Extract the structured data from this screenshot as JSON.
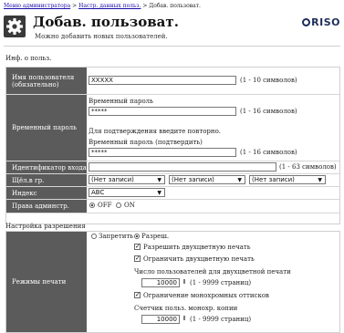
{
  "breadcrumb": {
    "items": [
      "Меню администратора",
      "Настр. данных польз.",
      "Добав. пользоват."
    ],
    "separator": ">"
  },
  "page": {
    "title": "Добав. пользоват.",
    "subtitle": "Можно добавить новых пользователей.",
    "logo": "RISO"
  },
  "user_info": {
    "section_title": "Инф. о польз.",
    "username": {
      "label": "Имя пользователя (обязательно)",
      "value": "XXXXX",
      "hint": "(1 - 10 символов)"
    },
    "temp_password": {
      "label": "Временный пароль",
      "caption1": "Временный пароль",
      "value1": "*****",
      "hint1": "(1 - 16 символов)",
      "confirm_note": "Для подтверждения введите повторно.",
      "caption2": "Временный пароль (подтвердить)",
      "value2": "*****",
      "hint2": "(1 - 16 символов)"
    },
    "login_id": {
      "label": "Идентификатор входа",
      "value": "",
      "hint": "(1 - 63 символов)"
    },
    "group": {
      "label": "Щёл.в гр.",
      "options": [
        "(Нет записи)",
        "(Нет записи)",
        "(Нет записи)"
      ]
    },
    "index": {
      "label": "Индекс",
      "value": "ABC"
    },
    "admin": {
      "label": "Права админстр.",
      "off": "OFF",
      "on": "ON",
      "selected": "OFF"
    }
  },
  "permissions": {
    "section_title": "Настройка разрешения",
    "print_mode": {
      "label": "Режимы печати",
      "deny": "Запретить",
      "allow": "Разреш.",
      "selected": "allow",
      "allow_duplex": "Разрешить двухцветную печать",
      "limit_duplex": "Ограничить двухцветную печать",
      "duplex_count_label": "Число пользователей для двухцветной печати",
      "duplex_count_value": "10000",
      "duplex_range": "(1 - 9999 страниц)",
      "limit_mono": "Ограничение монохромных оттисков",
      "mono_count_label": "Счетчик польз. монохр. копии",
      "mono_count_value": "10000",
      "mono_range": "(1 - 9999 страниц)",
      "checks": {
        "allow_duplex": true,
        "limit_duplex": true,
        "limit_mono": true
      }
    }
  }
}
